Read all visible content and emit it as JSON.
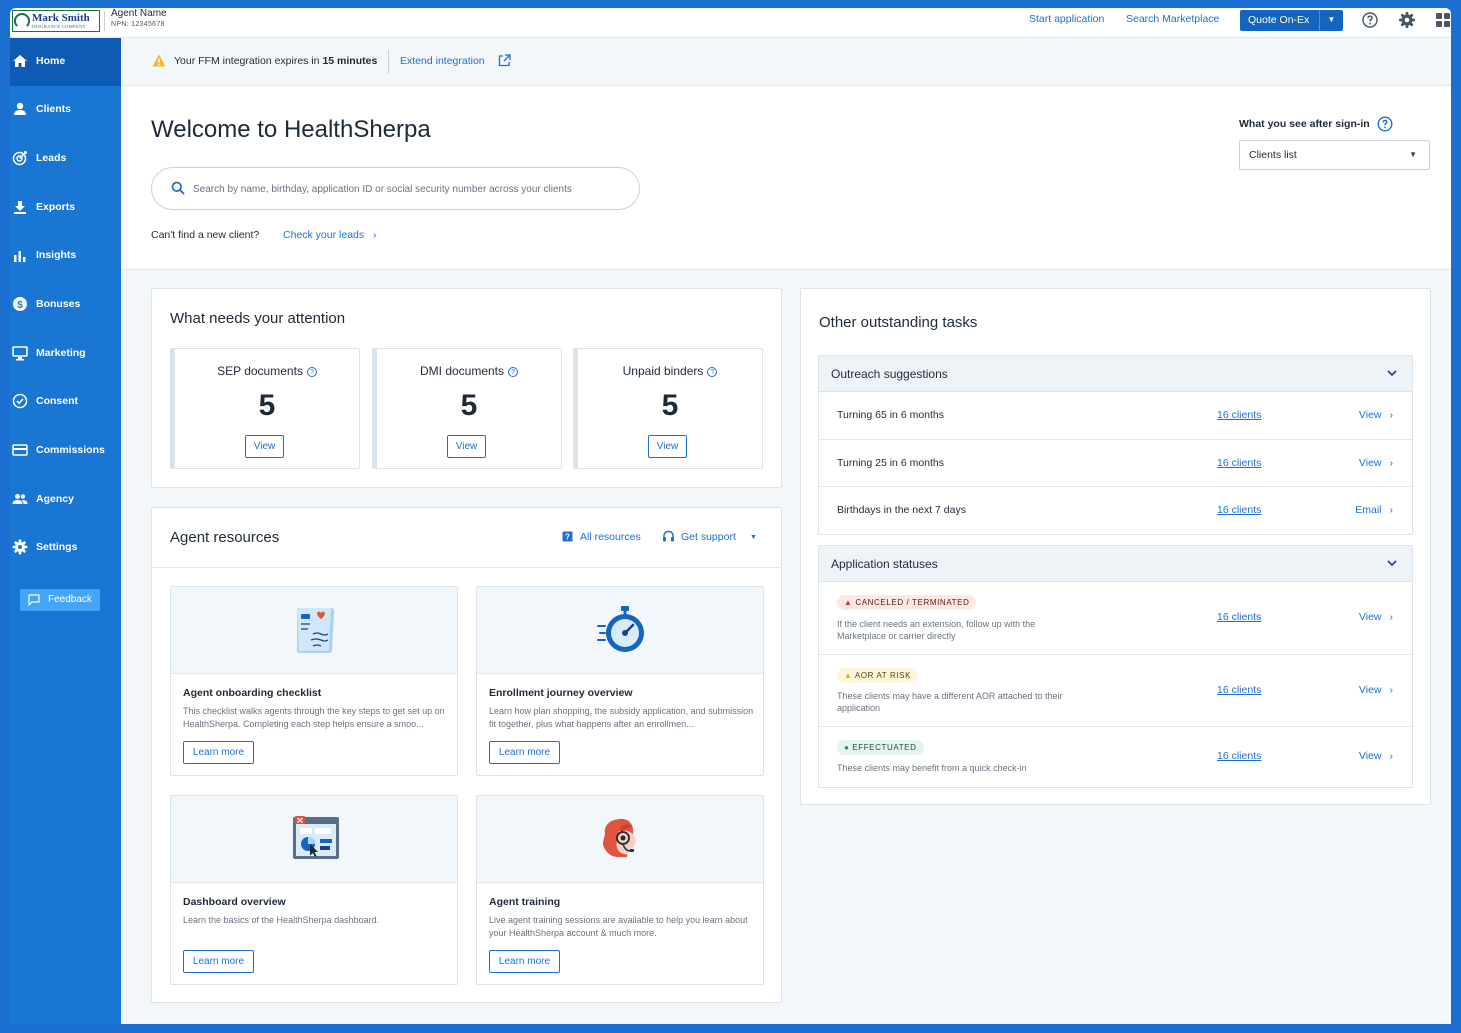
{
  "topbar": {
    "logo_name": "Mark Smith",
    "logo_sub": "INSURANCE COMPANY",
    "agent_name": "Agent Name",
    "agent_npn": "NPN: 12345678",
    "start_application": "Start application",
    "search_marketplace": "Search Marketplace",
    "quote_button": "Quote On-Ex"
  },
  "sidebar": {
    "items": [
      {
        "label": "Home",
        "icon": "home-icon"
      },
      {
        "label": "Clients",
        "icon": "person-icon"
      },
      {
        "label": "Leads",
        "icon": "target-icon"
      },
      {
        "label": "Exports",
        "icon": "download-icon"
      },
      {
        "label": "Insights",
        "icon": "bar-chart-icon"
      },
      {
        "label": "Bonuses",
        "icon": "dollar-icon"
      },
      {
        "label": "Marketing",
        "icon": "monitor-icon"
      },
      {
        "label": "Consent",
        "icon": "check-circle-icon"
      },
      {
        "label": "Commissions",
        "icon": "card-icon"
      },
      {
        "label": "Agency",
        "icon": "group-icon"
      },
      {
        "label": "Settings",
        "icon": "gear-icon"
      }
    ],
    "feedback": "Feedback"
  },
  "banner": {
    "text_prefix": "Your FFM integration expires in ",
    "text_bold": "15 minutes",
    "link": "Extend integration"
  },
  "welcome": {
    "title": "Welcome to HealthSherpa",
    "search_placeholder": "Search by name, birthday, application ID or social security number across your clients",
    "cant_find": "Can't find a new client?",
    "check_leads": "Check your leads",
    "signin_label": "What you see after sign-in",
    "signin_value": "Clients list"
  },
  "attention": {
    "title": "What needs your attention",
    "metrics": [
      {
        "label": "SEP documents",
        "value": "5",
        "button": "View"
      },
      {
        "label": "DMI documents",
        "value": "5",
        "button": "View"
      },
      {
        "label": "Unpaid binders",
        "value": "5",
        "button": "View"
      }
    ]
  },
  "resources": {
    "title": "Agent resources",
    "all_resources": "All resources",
    "get_support": "Get support",
    "tiles": [
      {
        "title": "Agent onboarding checklist",
        "desc": "This checklist walks agents through the key steps to get set up on HealthSherpa. Completing each step helps ensure a smoo...",
        "button": "Learn more",
        "icon": "checklist-illustration"
      },
      {
        "title": "Enrollment journey overview",
        "desc": "Learn how plan shopping, the subsidy application, and submission fit together, plus what happens after an enrollmen...",
        "button": "Learn more",
        "icon": "stopwatch-illustration"
      },
      {
        "title": "Dashboard overview",
        "desc": "Learn the basics of the HealthSherpa dashboard.",
        "button": "Learn more",
        "icon": "dashboard-illustration"
      },
      {
        "title": "Agent training",
        "desc": "Live agent training sessions are available to help you learn about your HealthSherpa account & much more.",
        "button": "Learn more",
        "icon": "headset-agent-illustration"
      }
    ]
  },
  "tasks": {
    "title": "Other outstanding tasks",
    "outreach": {
      "label": "Outreach suggestions",
      "rows": [
        {
          "label": "Turning 65 in 6 months",
          "clients": "16 clients",
          "action": "View"
        },
        {
          "label": "Turning 25 in 6 months",
          "clients": "16 clients",
          "action": "View"
        },
        {
          "label": "Birthdays in the next 7 days",
          "clients": "16 clients",
          "action": "Email"
        }
      ]
    },
    "statuses": {
      "label": "Application statuses",
      "rows": [
        {
          "badge": "CANCELED / TERMINATED",
          "desc": "If the client needs an extension, follow up with the Marketplace or carrier directly",
          "clients": "16 clients",
          "action": "View",
          "color": "#d93025"
        },
        {
          "badge": "AOR AT RISK",
          "desc": "These clients may have a different AOR attached to their application",
          "clients": "16 clients",
          "action": "View",
          "color": "#f2a900"
        },
        {
          "badge": "EFFECTUATED",
          "desc": "These clients may benefit from a quick check-in",
          "clients": "16 clients",
          "action": "View",
          "color": "#1e8e5a"
        }
      ]
    }
  },
  "colors": {
    "sidebar": "#1976d2",
    "sidebar_active": "#0d5bb5",
    "accent": "#1f6fd1",
    "outer_frame": "#1a6fd1"
  }
}
